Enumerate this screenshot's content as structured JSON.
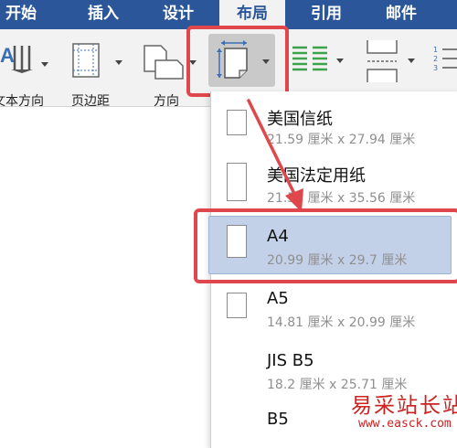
{
  "ribbon_tabs": [
    {
      "label": "开始"
    },
    {
      "label": "插入"
    },
    {
      "label": "设计"
    },
    {
      "label": "布局"
    },
    {
      "label": "引用"
    },
    {
      "label": "邮件"
    }
  ],
  "active_tab": "布局",
  "toolbar": {
    "text_direction_label": "文本方向",
    "margins_label": "页边距",
    "orientation_label": "方向"
  },
  "size_menu": {
    "items": [
      {
        "name": "美国信纸",
        "dimensions": "21.59 厘米 x 27.94 厘米"
      },
      {
        "name": "美国法定用纸",
        "dimensions": "21.59 厘米 x 35.56 厘米"
      },
      {
        "name": "A4",
        "dimensions": "20.99 厘米 x 29.7 厘米"
      },
      {
        "name": "A5",
        "dimensions": "14.81 厘米 x 20.99 厘米"
      },
      {
        "name": "JIS B5",
        "dimensions": "18.2 厘米 x 25.71 厘米"
      },
      {
        "name": "B5",
        "dimensions": ""
      }
    ],
    "selected": "A4"
  },
  "colors": {
    "ribbon_blue": "#2b579a",
    "highlight_red": "#e0474c",
    "selected_item_bg": "#c3d1e8"
  },
  "watermark": {
    "site_name": "易采站长站",
    "url": "www.easck.com"
  }
}
